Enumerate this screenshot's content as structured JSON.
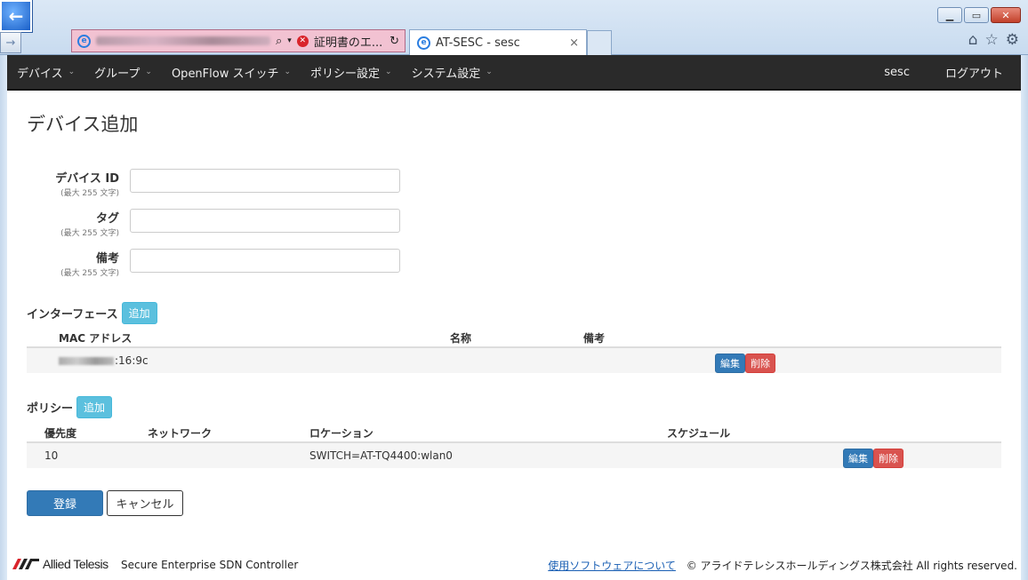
{
  "browser": {
    "tab_title": "AT-SESC - sesc",
    "cert_error": "証明書のエ...",
    "tab_close": "×"
  },
  "navbar": {
    "items": [
      {
        "label": "デバイス"
      },
      {
        "label": "グループ"
      },
      {
        "label": "OpenFlow スイッチ"
      },
      {
        "label": "ポリシー設定"
      },
      {
        "label": "システム設定"
      }
    ],
    "user": "sesc",
    "logout": "ログアウト"
  },
  "page": {
    "title": "デバイス追加"
  },
  "form": {
    "fields": [
      {
        "label": "デバイス ID",
        "hint": "(最大 255 文字)",
        "value": ""
      },
      {
        "label": "タグ",
        "hint": "(最大 255 文字)",
        "value": ""
      },
      {
        "label": "備考",
        "hint": "(最大 255 文字)",
        "value": ""
      }
    ]
  },
  "interfaces": {
    "label": "インターフェース",
    "add_label": "追加",
    "columns": [
      "MAC アドレス",
      "名称",
      "備考"
    ],
    "rows": [
      {
        "mac_suffix": ":16:9c",
        "name": "",
        "note": "",
        "edit": "編集",
        "delete": "削除"
      }
    ]
  },
  "policies": {
    "label": "ポリシー",
    "add_label": "追加",
    "columns": [
      "優先度",
      "ネットワーク",
      "ロケーション",
      "スケジュール"
    ],
    "rows": [
      {
        "priority": "10",
        "network": "",
        "location": "SWITCH=AT-TQ4400:wlan0",
        "schedule": "",
        "edit": "編集",
        "delete": "削除"
      }
    ]
  },
  "actions": {
    "submit": "登録",
    "cancel": "キャンセル"
  },
  "footer": {
    "brand": "Allied Telesis",
    "product": "Secure Enterprise SDN Controller",
    "software_link": "使用ソフトウェアについて",
    "copyright": "© アライドテレシスホールディングス株式会社 All rights reserved."
  },
  "colors": {
    "navbar_bg": "#2a2a2a",
    "primary": "#337ab7",
    "info": "#5bc0de",
    "danger": "#d9534f"
  }
}
